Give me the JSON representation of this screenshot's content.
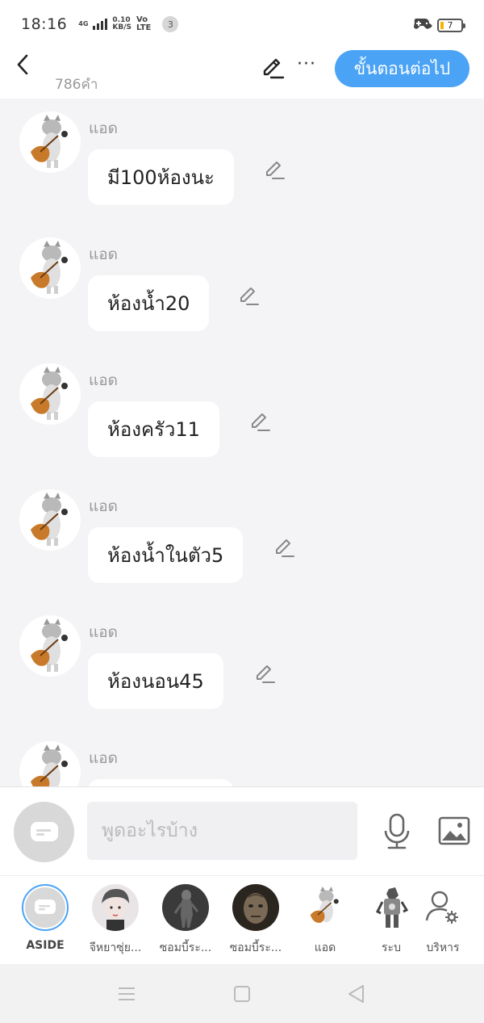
{
  "status_bar": {
    "time": "18:16",
    "network_type": "4G",
    "speed_value": "0.10",
    "speed_unit": "KB/S",
    "volte_top": "Vo",
    "volte_bottom": "LTE",
    "notification_count": "3",
    "battery_level": "7"
  },
  "header": {
    "word_count": "786คำ",
    "next_button_label": "ขั้นตอนต่อไป",
    "more_label": "···"
  },
  "messages": [
    {
      "sender": "แอด",
      "text": "มี100ห้องนะ"
    },
    {
      "sender": "แอด",
      "text": "ห้องน้ำ20"
    },
    {
      "sender": "แอด",
      "text": "ห้องครัว11"
    },
    {
      "sender": "แอด",
      "text": "ห้องน้ำในตัว5"
    },
    {
      "sender": "แอด",
      "text": "ห้องนอน45"
    },
    {
      "sender": "แอด",
      "text": ""
    }
  ],
  "composer": {
    "placeholder": "พูดอะไรบ้าง"
  },
  "characters": [
    {
      "label": "ASIDE",
      "icon": "aside-bubble-icon"
    },
    {
      "label": "จีหยาซุ่ย...",
      "icon": "avatar-portrait"
    },
    {
      "label": "ซอมบี้ระ...",
      "icon": "avatar-zombie"
    },
    {
      "label": "ซอมบี้ระ...",
      "icon": "avatar-zombie-face"
    },
    {
      "label": "แอด",
      "icon": "avatar-cat"
    },
    {
      "label": "ระบ",
      "icon": "avatar-robot"
    },
    {
      "label": "บริหาร",
      "icon": "manage-user-icon"
    }
  ],
  "colors": {
    "accent": "#4aa3f5",
    "background": "#f4f4f6",
    "aside_ring": "#4aa3f5"
  }
}
